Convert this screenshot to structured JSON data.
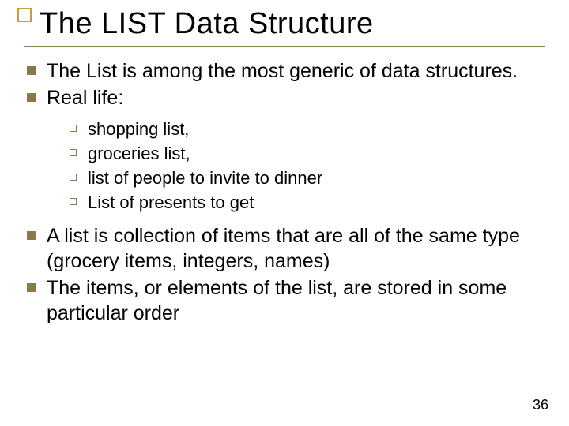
{
  "title": "The LIST Data Structure",
  "bullets1a": [
    "The List is among the most generic of data structures.",
    "Real life:"
  ],
  "sub": [
    "shopping list,",
    "groceries list,",
    "list of people to invite to dinner",
    "List of presents to get"
  ],
  "bullets1b": [
    "A list is collection of items that are all of the same type (grocery items, integers, names)",
    "The items, or elements of the list, are stored in some particular order"
  ],
  "pageNumber": "36"
}
